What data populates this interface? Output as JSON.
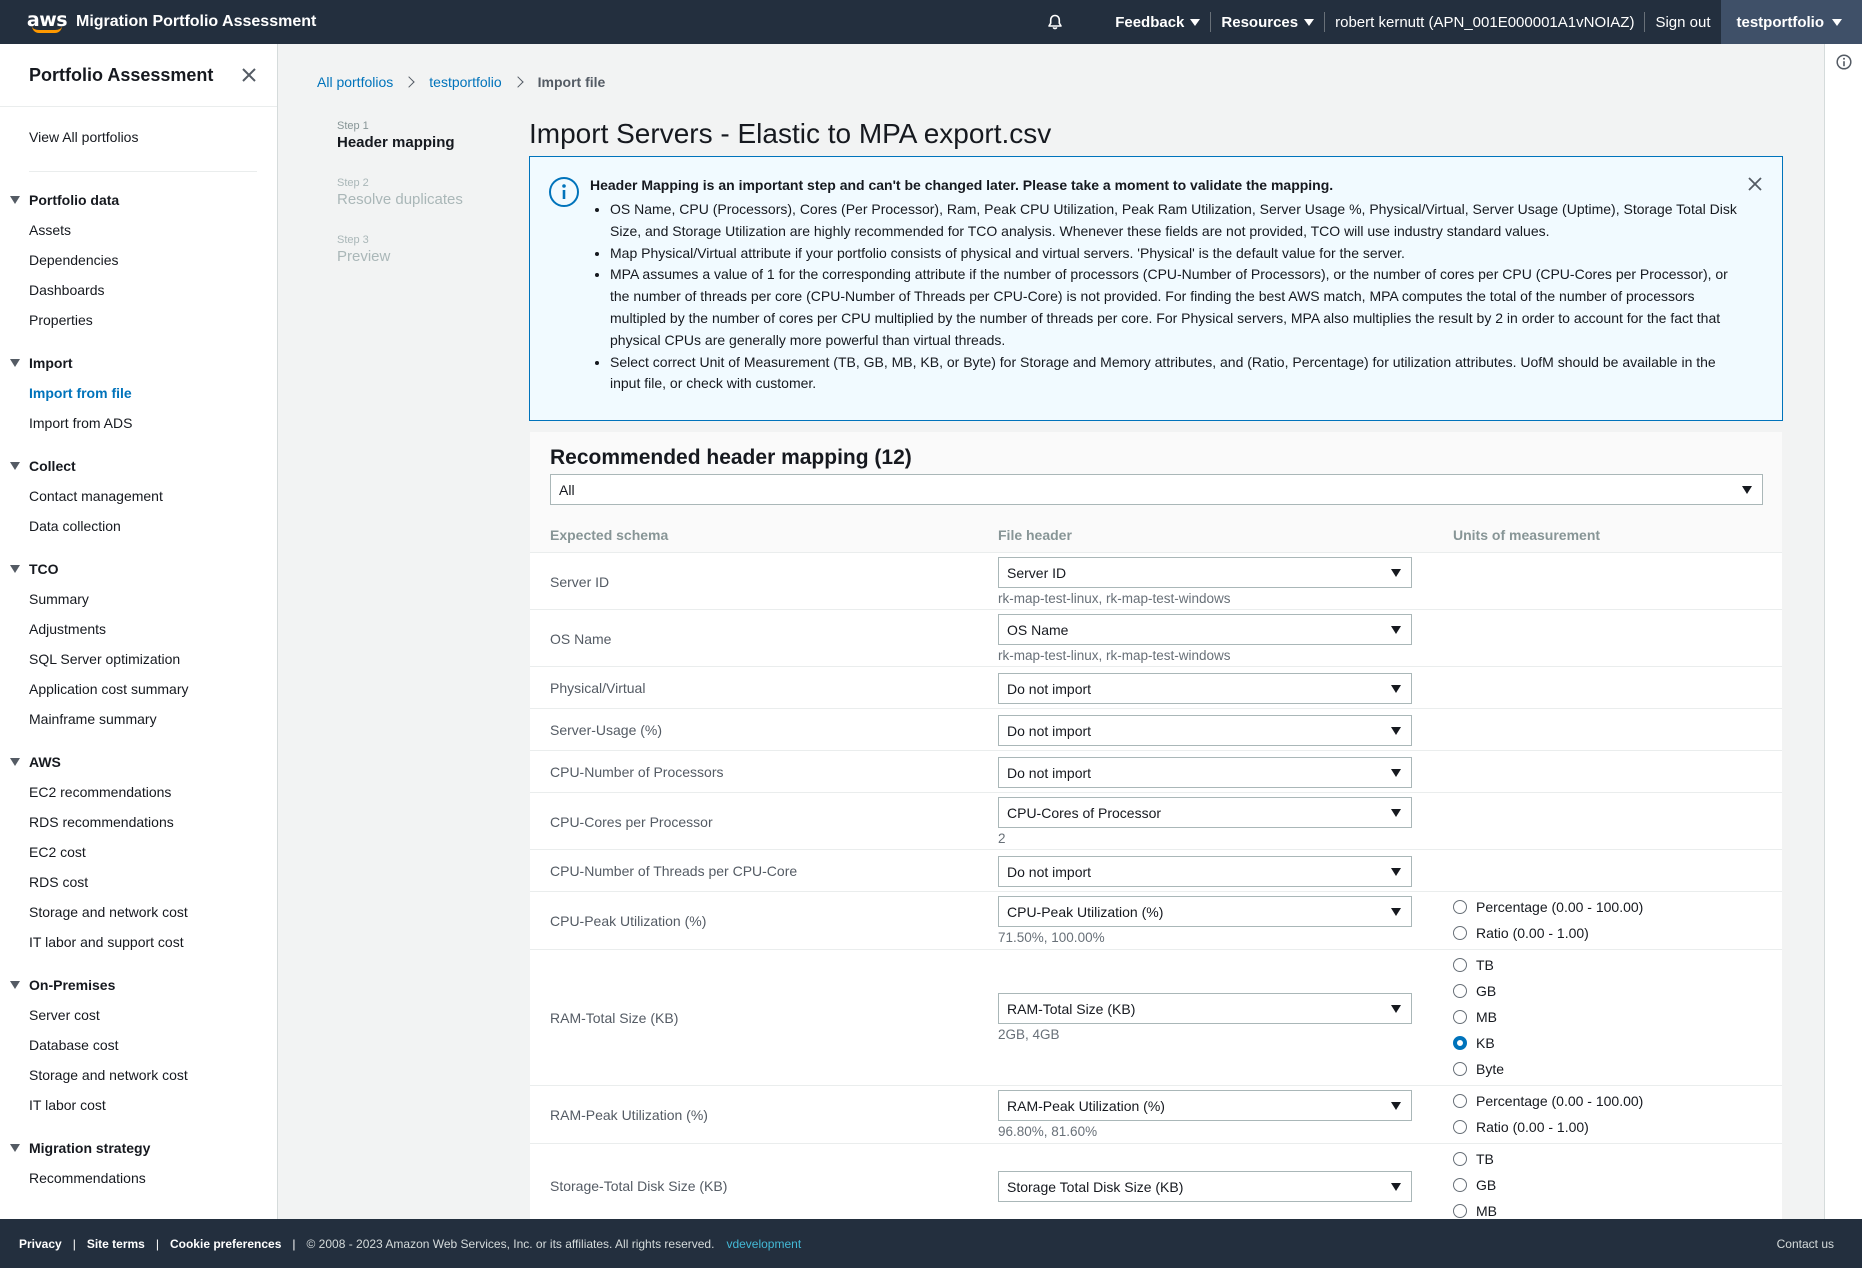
{
  "topbar": {
    "logo_text": "aws",
    "app_title": "Migration Portfolio Assessment",
    "feedback": "Feedback",
    "resources": "Resources",
    "user": "robert kernutt (APN_001E000001A1vNOIAZ)",
    "sign_out": "Sign out",
    "portfolio": "testportfolio"
  },
  "sidebar": {
    "title": "Portfolio Assessment",
    "view_all": "View All portfolios",
    "sections": [
      {
        "title": "Portfolio data",
        "items": [
          "Assets",
          "Dependencies",
          "Dashboards",
          "Properties"
        ]
      },
      {
        "title": "Import",
        "items": [
          "Import from file",
          "Import from ADS"
        ]
      },
      {
        "title": "Collect",
        "items": [
          "Contact management",
          "Data collection"
        ]
      },
      {
        "title": "TCO",
        "items": [
          "Summary",
          "Adjustments",
          "SQL Server optimization",
          "Application cost summary",
          "Mainframe summary"
        ]
      },
      {
        "title": "AWS",
        "items": [
          "EC2 recommendations",
          "RDS recommendations",
          "EC2 cost",
          "RDS cost",
          "Storage and network cost",
          "IT labor and support cost"
        ]
      },
      {
        "title": "On-Premises",
        "items": [
          "Server cost",
          "Database cost",
          "Storage and network cost",
          "IT labor cost"
        ]
      },
      {
        "title": "Migration strategy",
        "items": [
          "Recommendations"
        ]
      }
    ],
    "active_item": "Import from file"
  },
  "breadcrumb": {
    "items": [
      "All portfolios",
      "testportfolio"
    ],
    "current": "Import file"
  },
  "steps": [
    {
      "num": "Step 1",
      "name": "Header mapping"
    },
    {
      "num": "Step 2",
      "name": "Resolve duplicates"
    },
    {
      "num": "Step 3",
      "name": "Preview"
    }
  ],
  "page_title": "Import Servers - Elastic to MPA export.csv",
  "alert": {
    "heading": "Header Mapping is an important step and can't be changed later. Please take a moment to validate the mapping.",
    "bullets": [
      "OS Name, CPU (Processors), Cores (Per Processor), Ram, Peak CPU Utilization, Peak Ram Utilization, Server Usage %, Physical/Virtual, Server Usage (Uptime), Storage Total Disk Size, and Storage Utilization are highly recommended for TCO analysis. Whenever these fields are not provided, TCO will use industry standard values.",
      "Map Physical/Virtual attribute if your portfolio consists of physical and virtual servers. 'Physical' is the default value for the server.",
      "MPA assumes a value of 1 for the corresponding attribute if the number of processors (CPU-Number of Processors), or the number of cores per CPU (CPU-Cores per Processor), or the number of threads per core (CPU-Number of Threads per CPU-Core) is not provided. For finding the best AWS match, MPA computes the total of the number of processors multipled by the number of cores per CPU multiplied by the number of threads per core. For Physical servers, MPA also multiplies the result by 2 in order to account for the fact that physical CPUs are generally more powerful than virtual threads.",
      "Select correct Unit of Measurement (TB, GB, MB, KB, or Byte) for Storage and Memory attributes, and (Ratio, Percentage) for utilization attributes. UofM should be available in the input file, or check with customer."
    ]
  },
  "mapping": {
    "title": "Recommended header mapping (12)",
    "filter_value": "All",
    "columns": [
      "Expected schema",
      "File header",
      "Units of measurement"
    ],
    "rows": [
      {
        "label": "Server ID",
        "value": "Server ID",
        "sample": "rk-map-test-linux, rk-map-test-windows"
      },
      {
        "label": "OS Name",
        "value": "OS Name",
        "sample": "rk-map-test-linux, rk-map-test-windows"
      },
      {
        "label": "Physical/Virtual",
        "value": "Do not import"
      },
      {
        "label": "Server-Usage (%)",
        "value": "Do not import"
      },
      {
        "label": "CPU-Number of Processors",
        "value": "Do not import"
      },
      {
        "label": "CPU-Cores per Processor",
        "value": "CPU-Cores of Processor",
        "sample": "2"
      },
      {
        "label": "CPU-Number of Threads per CPU-Core",
        "value": "Do not import"
      },
      {
        "label": "CPU-Peak Utilization (%)",
        "value": "CPU-Peak Utilization (%)",
        "sample": "71.50%, 100.00%",
        "units": [
          "Percentage (0.00 - 100.00)",
          "Ratio (0.00 - 1.00)"
        ],
        "selected": null
      },
      {
        "label": "RAM-Total Size (KB)",
        "value": "RAM-Total Size (KB)",
        "sample": "2GB, 4GB",
        "units": [
          "TB",
          "GB",
          "MB",
          "KB",
          "Byte"
        ],
        "selected": "KB"
      },
      {
        "label": "RAM-Peak Utilization (%)",
        "value": "RAM-Peak Utilization (%)",
        "sample": "96.80%, 81.60%",
        "units": [
          "Percentage (0.00 - 100.00)",
          "Ratio (0.00 - 1.00)"
        ],
        "selected": null
      },
      {
        "label": "Storage-Total Disk Size (KB)",
        "value": "Storage Total Disk Size (KB)",
        "units": [
          "TB",
          "GB",
          "MB"
        ],
        "selected": null
      }
    ]
  },
  "footer": {
    "links": [
      "Privacy",
      "Site terms",
      "Cookie preferences"
    ],
    "copyright": "© 2008 - 2023 Amazon Web Services, Inc. or its affiliates. All rights reserved.",
    "env": "vdevelopment",
    "contact": "Contact us"
  }
}
